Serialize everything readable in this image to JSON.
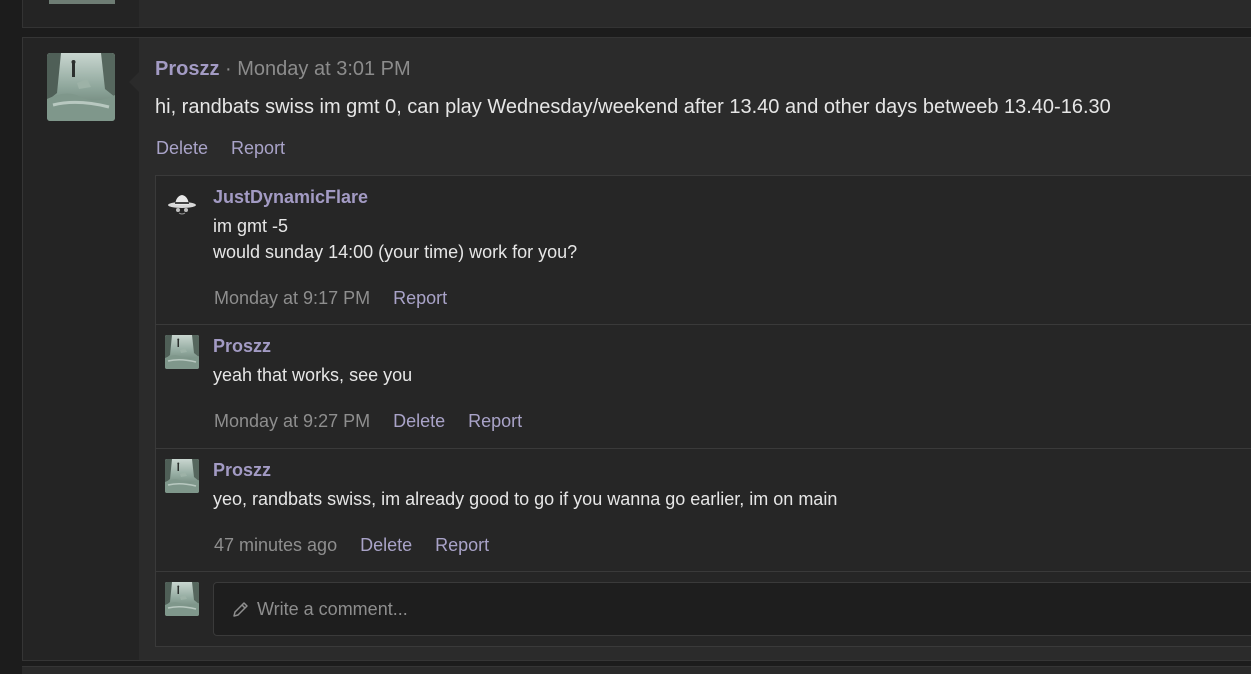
{
  "message": {
    "author": "Proszz",
    "separator": " · ",
    "timestamp": "Monday at 3:01 PM",
    "body": "hi, randbats swiss im gmt 0, can play Wednesday/weekend after 13.40 and other days betweeb 13.40-16.30",
    "actions": {
      "delete": "Delete",
      "report": "Report"
    }
  },
  "comments": [
    {
      "author": "JustDynamicFlare",
      "lines": [
        "im gmt -5",
        "would sunday 14:00 (your time) work for you?"
      ],
      "time": "Monday at 9:17 PM",
      "report": "Report"
    },
    {
      "author": "Proszz",
      "lines": [
        "yeah that works, see you"
      ],
      "time": "Monday at 9:27 PM",
      "delete": "Delete",
      "report": "Report"
    },
    {
      "author": "Proszz",
      "lines": [
        "yeo, randbats swiss, im already good to go if you wanna go earlier, im on main"
      ],
      "time": "47 minutes ago",
      "delete": "Delete",
      "report": "Report"
    }
  ],
  "comment_input": {
    "placeholder": "Write a comment..."
  },
  "icons": {
    "avatar_proszz": "landscape-avatar-icon",
    "avatar_justdynamicflare": "hat-avatar-icon",
    "pencil": "pencil-icon"
  },
  "colors": {
    "username": "#a39bc4",
    "link": "#a9a3c8",
    "background": "#1c1c1c",
    "panel": "#2b2b2b"
  }
}
